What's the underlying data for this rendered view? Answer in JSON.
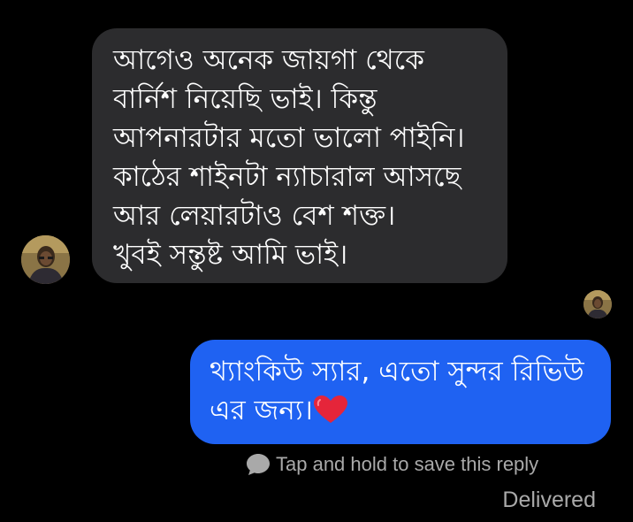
{
  "conversation": {
    "incoming_message": {
      "lines": [
        "আগেও অনেক জায়গা থেকে",
        "বার্নিশ নিয়েছি ভাই। কিন্তু",
        "আপনারটার মতো ভালো পাইনি।",
        "কাঠের শাইনটা ন্যাচারাল আসছে",
        "আর লেয়ারটাও বেশ শক্ত।",
        "খুবই সন্তুষ্ট আমি ভাই।"
      ],
      "bubble_color": "#2c2c2e",
      "avatar_icon": "profile-photo"
    },
    "outgoing_message": {
      "lines": [
        "থ্যাংকিউ স্যার, এতো সুন্দর রিভিউ",
        "এর জন্য।"
      ],
      "emoji": "red-heart-icon",
      "bubble_color": "#1f62f2"
    },
    "seen_indicator": {
      "icon": "seen-avatar"
    },
    "save_hint": {
      "icon": "speech-bubble-icon",
      "text": "Tap and hold to save this reply"
    },
    "status": "Delivered"
  }
}
